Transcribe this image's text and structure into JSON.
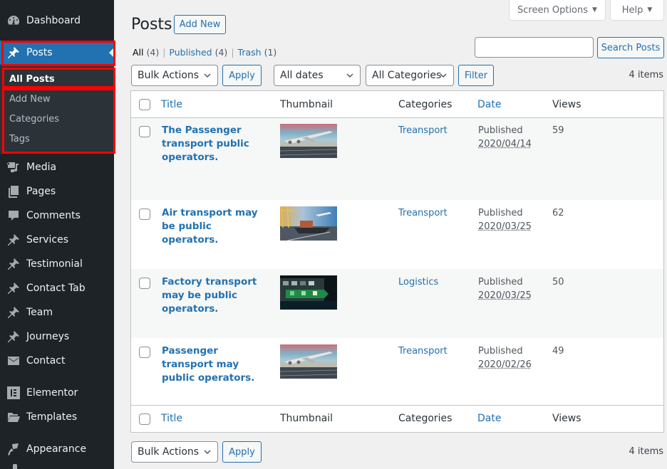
{
  "sidebar": {
    "items": [
      {
        "label": "Dashboard",
        "icon": "dashboard-icon"
      },
      {
        "label": "Posts",
        "icon": "pin-icon",
        "current": true
      },
      {
        "label": "Media",
        "icon": "media-icon"
      },
      {
        "label": "Pages",
        "icon": "pages-icon"
      },
      {
        "label": "Comments",
        "icon": "comments-icon"
      },
      {
        "label": "Services",
        "icon": "pin-icon"
      },
      {
        "label": "Testimonial",
        "icon": "pin-icon"
      },
      {
        "label": "Contact Tab",
        "icon": "pin-icon"
      },
      {
        "label": "Team",
        "icon": "pin-icon"
      },
      {
        "label": "Journeys",
        "icon": "pin-icon"
      },
      {
        "label": "Contact",
        "icon": "envelope-icon"
      },
      {
        "label": "Elementor",
        "icon": "elementor-icon"
      },
      {
        "label": "Templates",
        "icon": "folder-icon"
      },
      {
        "label": "Appearance",
        "icon": "paintbrush-icon"
      }
    ],
    "submenu": [
      {
        "label": "All Posts",
        "active": true
      },
      {
        "label": "Add New"
      },
      {
        "label": "Categories"
      },
      {
        "label": "Tags"
      }
    ]
  },
  "top_tabs": {
    "screen_options": "Screen Options",
    "help": "Help",
    "arrow": "▼"
  },
  "header": {
    "title": "Posts",
    "add_new": "Add New"
  },
  "views_filter": {
    "all": {
      "label": "All",
      "count": "(4)"
    },
    "published": {
      "label": "Published",
      "count": "(4)"
    },
    "trash": {
      "label": "Trash",
      "count": "(1)"
    },
    "separator": "|"
  },
  "search": {
    "value": "",
    "button": "Search Posts"
  },
  "tablenav_top": {
    "bulk_actions": "Bulk Actions",
    "apply": "Apply",
    "dates": "All dates",
    "categories": "All Categories",
    "filter": "Filter",
    "items": "4 items"
  },
  "tablenav_bottom": {
    "bulk_actions": "Bulk Actions",
    "apply": "Apply",
    "items": "4 items"
  },
  "table": {
    "columns": [
      "Title",
      "Thumbnail",
      "Categories",
      "Date",
      "Views"
    ],
    "rows": [
      {
        "title": "The Passenger transport public operators.",
        "thumbnail": "airplane-takeoff",
        "category": "Treansport",
        "status": "Published",
        "date": "2020/04/14",
        "views": "59"
      },
      {
        "title": "Air transport may be public operators.",
        "thumbnail": "cargo-ship-plane",
        "category": "Treansport",
        "status": "Published",
        "date": "2020/03/25",
        "views": "62"
      },
      {
        "title": "Factory transport may be public operators.",
        "thumbnail": "container-ship-night",
        "category": "Logistics",
        "status": "Published",
        "date": "2020/03/25",
        "views": "50"
      },
      {
        "title": "Passenger transport may public operators.",
        "thumbnail": "airplane-takeoff",
        "category": "Treansport",
        "status": "Published",
        "date": "2020/02/26",
        "views": "49"
      }
    ]
  },
  "colors": {
    "sidebar_bg": "#1d2327",
    "submenu_bg": "#2c3338",
    "accent": "#2271b1",
    "highlight": "#ff0000"
  }
}
